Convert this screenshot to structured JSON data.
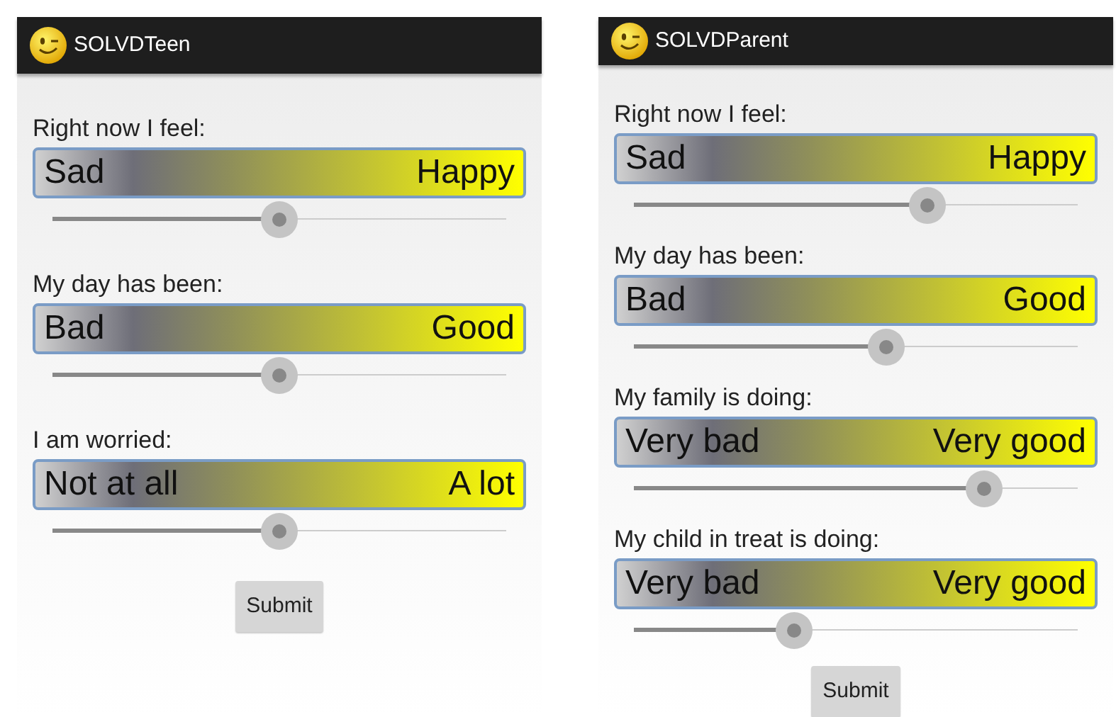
{
  "screens": [
    {
      "app_title": "SOLVDTeen",
      "questions": [
        {
          "label": "Right now I feel:",
          "low": "Sad",
          "high": "Happy",
          "level": 0.5
        },
        {
          "label": "My day has been:",
          "low": "Bad",
          "high": "Good",
          "level": 0.5
        },
        {
          "label": "I am worried:",
          "low": "Not at all",
          "high": "A lot",
          "level": 0.5
        }
      ],
      "submit": "Submit"
    },
    {
      "app_title": "SOLVDParent",
      "questions": [
        {
          "label": "Right now I feel:",
          "low": "Sad",
          "high": "Happy",
          "level": 0.66
        },
        {
          "label": "My day has been:",
          "low": "Bad",
          "high": "Good",
          "level": 0.57
        },
        {
          "label": "My family is doing:",
          "low": "Very bad",
          "high": "Very good",
          "level": 0.79
        },
        {
          "label": "My child in treat is doing:",
          "low": "Very bad",
          "high": "Very good",
          "level": 0.36
        }
      ],
      "submit": "Submit"
    }
  ]
}
